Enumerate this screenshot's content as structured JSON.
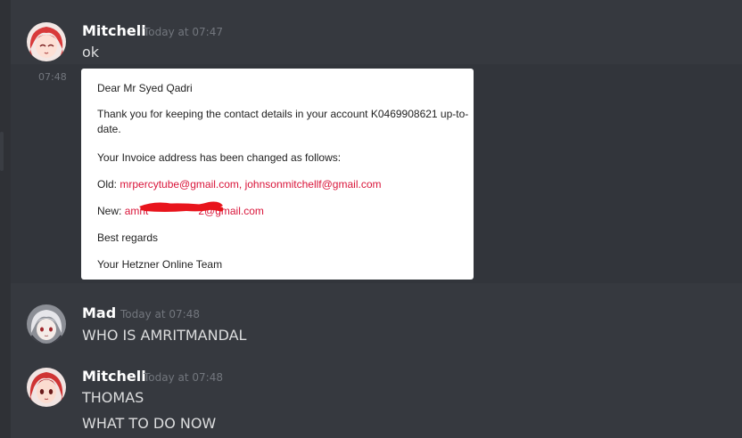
{
  "messages": [
    {
      "username": "Mitchell",
      "timestamp": "Today at 07:47",
      "lines": [
        "ok"
      ],
      "avatar_icon": "anime-red-hair-avatar"
    },
    {
      "side_timestamp": "07:48",
      "attachment": {
        "greeting": "Dear Mr Syed Qadri",
        "para1": "Thank you for keeping the contact details in your account K0469908621 up-to-date.",
        "para2": "Your Invoice address has been changed as follows:",
        "old_label": "Old:",
        "old_value": "mrpercytube@gmail.com, johnsonmitchellf@gmail.com",
        "new_label": "New:",
        "new_prefix": "amrit",
        "new_suffix": "2@gmail.com",
        "closing": "Best regards",
        "signature": "Your Hetzner Online Team"
      }
    },
    {
      "username": "Mad",
      "timestamp": "Today at 07:48",
      "lines": [
        "WHO IS AMRITMANDAL"
      ],
      "avatar_icon": "anime-silver-hair-avatar"
    },
    {
      "username": "Mitchell",
      "timestamp": "Today at 07:48",
      "lines": [
        "THOMAS",
        "WHAT TO DO NOW"
      ],
      "avatar_icon": "anime-red-hair-avatar"
    }
  ],
  "colors": {
    "background": "#36393f",
    "hover": "#32353b",
    "username": "#ffffff",
    "text": "#dcddde",
    "timestamp": "#72767d",
    "link_red": "#d9153a"
  }
}
